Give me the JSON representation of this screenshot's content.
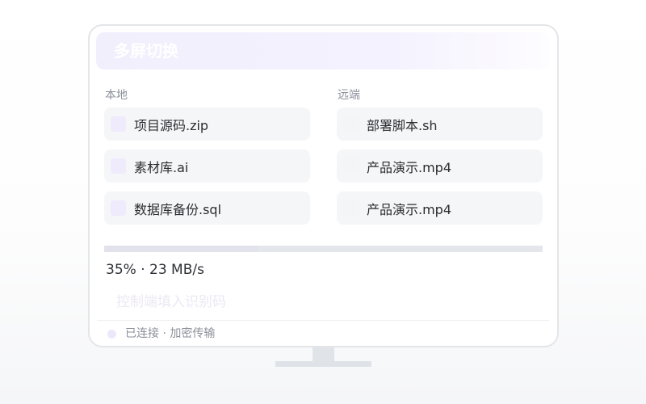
{
  "window": {
    "title": "多屏切换"
  },
  "local": {
    "label": "本地",
    "files": [
      {
        "name": "项目源码.zip",
        "icon": "file-icon"
      },
      {
        "name": "素材库.ai",
        "icon": "file-icon"
      },
      {
        "name": "数据库备份.sql",
        "icon": "file-icon"
      }
    ]
  },
  "remote": {
    "label": "远端",
    "files": [
      {
        "name": "部署脚本.sh",
        "icon": "file-icon"
      },
      {
        "name": "产品演示.mp4",
        "icon": "file-icon"
      },
      {
        "name": "产品演示.mp4",
        "icon": "file-icon"
      }
    ]
  },
  "transfer": {
    "progress": 0.35,
    "status_text": "35% · 23 MB/s"
  },
  "code_input": {
    "placeholder": "控制端填入识别码",
    "value": ""
  },
  "connection": {
    "status": "已连接 · 加密传输",
    "indicator_icon": "status-dot"
  },
  "colors": {
    "header_tint": "#f2effd",
    "file_icon_tint": "#efebfc",
    "progress_track": "#e3e7eb",
    "status_dot": "#ece8fb"
  }
}
